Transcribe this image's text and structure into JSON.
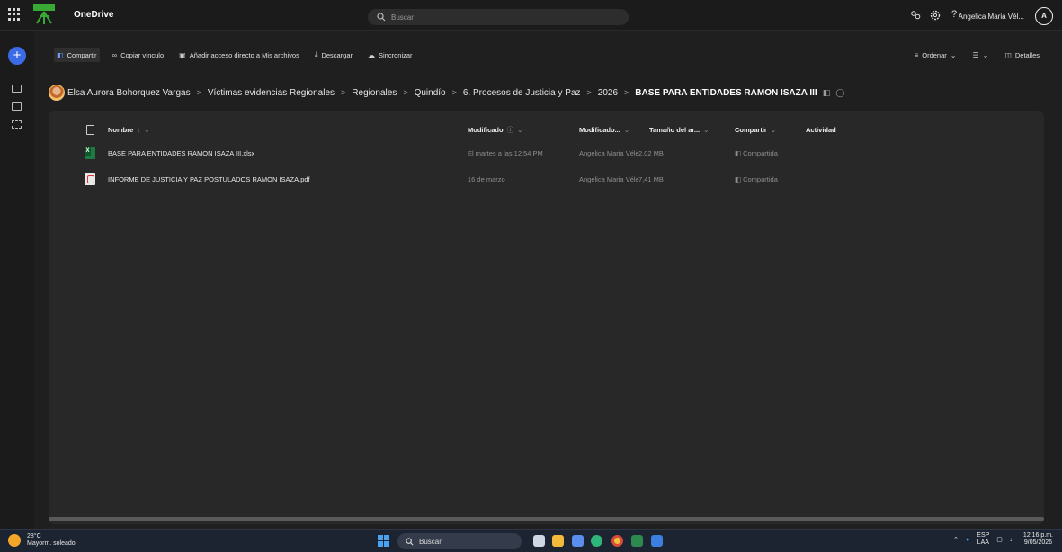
{
  "header": {
    "app_title": "OneDrive",
    "search_placeholder": "Buscar",
    "help": "?",
    "user_name": "Angelica Maria Vél...",
    "avatar_initial": "A"
  },
  "toolbar": {
    "share": "Compartir",
    "copy_link": "Copiar vínculo",
    "add_shortcut": "Añadir acceso directo a Mis archivos",
    "download": "Descargar",
    "sync": "Sincronizar",
    "sort": "Ordenar",
    "details": "Detalles"
  },
  "breadcrumb": {
    "items": [
      "Elsa Aurora Bohorquez Vargas",
      "Víctimas evidencias Regionales",
      "Regionales",
      "Quindío",
      "6. Procesos de Justicia y Paz",
      "2026"
    ],
    "current": "BASE PARA ENTIDADES RAMON ISAZA III"
  },
  "table": {
    "columns": {
      "name": "Nombre",
      "modified": "Modificado",
      "modified_by": "Modificado...",
      "size": "Tamaño del ar...",
      "sharing": "Compartir",
      "activity": "Actividad"
    },
    "rows": [
      {
        "icon": "excel-icon",
        "name": "BASE PARA ENTIDADES RAMON ISAZA III.xlsx",
        "modified": "El martes a las 12:54 PM",
        "modified_by": "Angelica Maria Véle",
        "size": "2,02 MB",
        "sharing": "Compartida"
      },
      {
        "icon": "pdf-icon",
        "name": "INFORME DE JUSTICIA Y PAZ POSTULADOS RAMON ISAZA.pdf",
        "modified": "16 de marzo",
        "modified_by": "Angelica Maria Véle",
        "size": "7,41 MB",
        "sharing": "Compartida"
      }
    ]
  },
  "taskbar": {
    "temperature": "28°C",
    "weather": "Mayorm. soleado",
    "search": "Buscar",
    "lang_top": "ESP",
    "lang_bottom": "LAA",
    "time": "12:16 p.m.",
    "date": "9/05/2026"
  },
  "colors": {
    "accent": "#3b6ce6",
    "background": "#1f1f1f",
    "panel": "#282828",
    "excel": "#1d7a43",
    "pdf": "#d33333"
  }
}
